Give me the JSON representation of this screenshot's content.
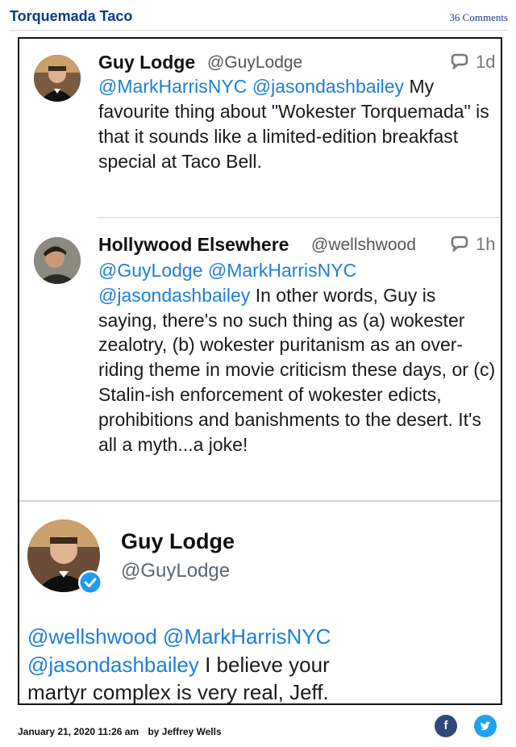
{
  "post": {
    "title": "Torquemada Taco",
    "comments": "36 Comments"
  },
  "tweets": [
    {
      "name": "Guy Lodge",
      "handle": "@GuyLodge",
      "time": "1d",
      "mentions": "@MarkHarrisNYC @jasondashbailey",
      "text": "My favourite thing about \"Wokester Torquemada\" is that it sounds like a limited-edition breakfast special at Taco Bell."
    },
    {
      "name": "Hollywood Elsewhere",
      "handle": "@wellshwood",
      "time": "1h",
      "mentions": "@GuyLodge @MarkHarrisNYC @jasondashbailey",
      "text": "In other words, Guy is saying, there's no such thing as (a) wokester zealotry, (b) wokester puritanism as an over-riding theme in movie criticism these days, or (c) Stalin-ish enforcement of wokester edicts, prohibitions and banishments to the desert.  It's all a myth...a joke!"
    },
    {
      "name": "Guy Lodge",
      "handle": "@GuyLodge",
      "mentions": "@wellshwood @MarkHarrisNYC @jasondashbailey",
      "text": "I believe your martyr complex is very real, Jeff."
    }
  ],
  "footer": {
    "date": "January 21, 2020 11:26 am",
    "byline": "by Jeffrey Wells",
    "facebook_glyph": "f",
    "twitter_glyph": "🐦"
  },
  "colors": {
    "mention": "#1d7fd6",
    "title": "#0d3b82",
    "verified": "#1d9bf0",
    "facebook": "#2e4a7a",
    "twitter": "#1da1f2"
  }
}
